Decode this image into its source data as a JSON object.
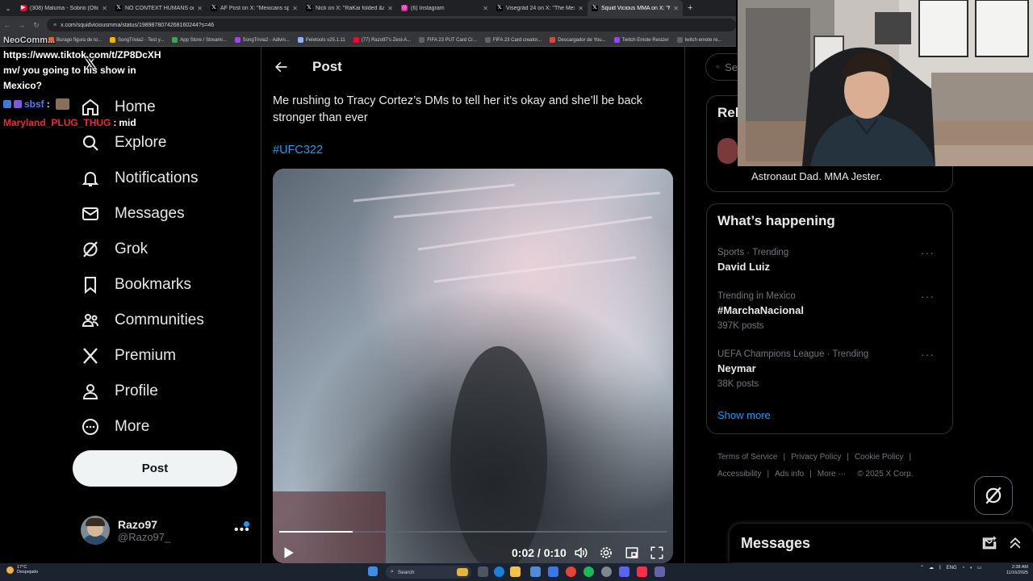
{
  "browser": {
    "tabs": [
      {
        "title": "(308) Maluma - Sobrio (Oficial",
        "favicon_color": "#ff0033",
        "favicon": "▶"
      },
      {
        "title": "NO CONTEXT HUMANS on X:",
        "favicon_color": "#000000",
        "favicon": "𝕏"
      },
      {
        "title": "AF Post on X: \"Mexicans spray",
        "favicon_color": "#000000",
        "favicon": "𝕏"
      },
      {
        "title": "Nick on X: \"RaKai folded &a",
        "favicon_color": "#000000",
        "favicon": "𝕏"
      },
      {
        "title": "(6) Instagram",
        "favicon_color": "#d6249f",
        "favicon": "◎"
      },
      {
        "title": "Visegrád 24 on X: \"The Mexico",
        "favicon_color": "#000000",
        "favicon": "𝕏"
      },
      {
        "title": "Squid Vicious MMA on X: \"Me",
        "favicon_color": "#000000",
        "favicon": "𝕏",
        "active": true
      }
    ],
    "url": "x.com/squidviciousmma/status/1989878074268160244?s=46",
    "bookmarks": [
      {
        "label": "Burago figura de to...",
        "color": "#e2673a"
      },
      {
        "label": "SongTrivia2 - Test y...",
        "color": "#f4b400"
      },
      {
        "label": "App Store / Streami...",
        "color": "#34a853"
      },
      {
        "label": "SongTrivia2 - Adivin...",
        "color": "#a142f4"
      },
      {
        "label": "Peletools v25.1.11",
        "color": "#8ab4f8"
      },
      {
        "label": "(77) Razo97's Zest-A...",
        "color": "#ff0033"
      },
      {
        "label": "FIFA 23 PUT Card Cr...",
        "color": "#5f6368"
      },
      {
        "label": "FIFA 23 Card creator...",
        "color": "#5f6368"
      },
      {
        "label": "Descargador de You...",
        "color": "#ea4335"
      },
      {
        "label": "Twitch Emote Resizer",
        "color": "#9146ff"
      },
      {
        "label": "twitch emote re...",
        "color": "#5f6368"
      }
    ]
  },
  "chat_overlay": {
    "line1": "NeoComm...",
    "line2": "https://www.tiktok.com/t/ZP8DcXH",
    "line3": "mv/ you going to his show in",
    "line4": "Mexico?",
    "user2": "sbsf",
    "user3": "Maryland_PLUG_THUG",
    "msg3": "mid",
    "user2_color": "#4f7cff",
    "user3_color": "#e8283c"
  },
  "sidebar": {
    "items": [
      {
        "label": "Home",
        "icon": "home-icon"
      },
      {
        "label": "Explore",
        "icon": "search-icon"
      },
      {
        "label": "Notifications",
        "icon": "bell-icon"
      },
      {
        "label": "Messages",
        "icon": "envelope-icon"
      },
      {
        "label": "Grok",
        "icon": "grok-icon"
      },
      {
        "label": "Bookmarks",
        "icon": "bookmark-icon"
      },
      {
        "label": "Communities",
        "icon": "people-icon"
      },
      {
        "label": "Premium",
        "icon": "x-logo-icon"
      },
      {
        "label": "Profile",
        "icon": "person-icon"
      },
      {
        "label": "More",
        "icon": "more-circle-icon"
      }
    ],
    "post_button": "Post",
    "account": {
      "name": "Razo97",
      "handle": "@Razo97_"
    }
  },
  "post": {
    "header": "Post",
    "text": "Me rushing to Tracy Cortez’s DMs to tell her it’s okay and she’ll be back stronger than ever",
    "hashtag": "#UFC322",
    "video": {
      "current_time": "0:02",
      "duration": "0:10",
      "progress": 0.19
    }
  },
  "right": {
    "search_placeholder": "Se",
    "relevant_heading": "Rel",
    "relevant_bio": "Astronaut Dad. MMA Jester.",
    "happening_heading": "What’s happening",
    "trends": [
      {
        "meta": "Sports · Trending",
        "name": "David Luiz",
        "count": ""
      },
      {
        "meta": "Trending in Mexico",
        "name": "#MarchaNacional",
        "count": "397K posts"
      },
      {
        "meta": "UEFA Champions League · Trending",
        "name": "Neymar",
        "count": "38K posts"
      }
    ],
    "show_more": "Show more",
    "footer": [
      "Terms of Service",
      "Privacy Policy",
      "Cookie Policy",
      "Accessibility",
      "Ads info",
      "More ···",
      "© 2025 X Corp."
    ],
    "messages_title": "Messages"
  },
  "taskbar": {
    "weather_temp": "17°C",
    "weather_desc": "Despejado",
    "search_label": "Search",
    "lang": "ENG",
    "time": "2:38 AM",
    "date": "11/16/2025"
  },
  "colors": {
    "accent": "#1d9bf0",
    "background": "#000000",
    "border": "#2f3336",
    "muted_text": "#71767b"
  }
}
